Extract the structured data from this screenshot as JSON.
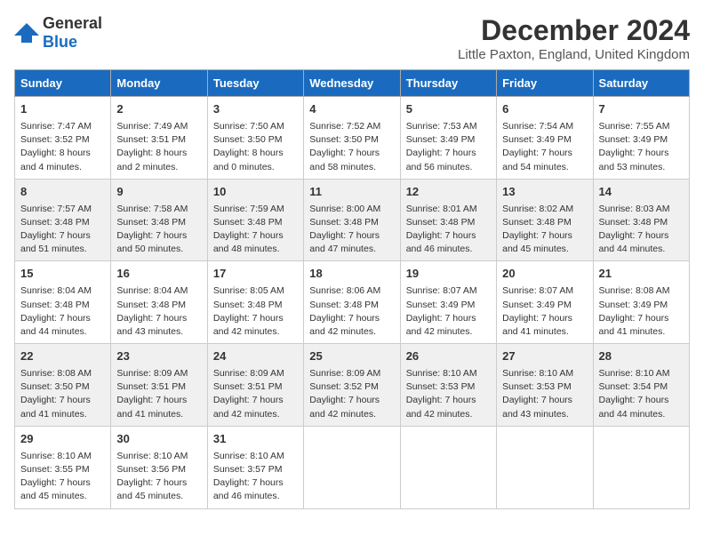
{
  "logo": {
    "general": "General",
    "blue": "Blue"
  },
  "title": "December 2024",
  "subtitle": "Little Paxton, England, United Kingdom",
  "colors": {
    "header_bg": "#1a6bbf",
    "odd_row": "#ffffff",
    "even_row": "#f0f0f0"
  },
  "columns": [
    "Sunday",
    "Monday",
    "Tuesday",
    "Wednesday",
    "Thursday",
    "Friday",
    "Saturday"
  ],
  "weeks": [
    [
      {
        "day": "1",
        "info": "Sunrise: 7:47 AM\nSunset: 3:52 PM\nDaylight: 8 hours\nand 4 minutes."
      },
      {
        "day": "2",
        "info": "Sunrise: 7:49 AM\nSunset: 3:51 PM\nDaylight: 8 hours\nand 2 minutes."
      },
      {
        "day": "3",
        "info": "Sunrise: 7:50 AM\nSunset: 3:50 PM\nDaylight: 8 hours\nand 0 minutes."
      },
      {
        "day": "4",
        "info": "Sunrise: 7:52 AM\nSunset: 3:50 PM\nDaylight: 7 hours\nand 58 minutes."
      },
      {
        "day": "5",
        "info": "Sunrise: 7:53 AM\nSunset: 3:49 PM\nDaylight: 7 hours\nand 56 minutes."
      },
      {
        "day": "6",
        "info": "Sunrise: 7:54 AM\nSunset: 3:49 PM\nDaylight: 7 hours\nand 54 minutes."
      },
      {
        "day": "7",
        "info": "Sunrise: 7:55 AM\nSunset: 3:49 PM\nDaylight: 7 hours\nand 53 minutes."
      }
    ],
    [
      {
        "day": "8",
        "info": "Sunrise: 7:57 AM\nSunset: 3:48 PM\nDaylight: 7 hours\nand 51 minutes."
      },
      {
        "day": "9",
        "info": "Sunrise: 7:58 AM\nSunset: 3:48 PM\nDaylight: 7 hours\nand 50 minutes."
      },
      {
        "day": "10",
        "info": "Sunrise: 7:59 AM\nSunset: 3:48 PM\nDaylight: 7 hours\nand 48 minutes."
      },
      {
        "day": "11",
        "info": "Sunrise: 8:00 AM\nSunset: 3:48 PM\nDaylight: 7 hours\nand 47 minutes."
      },
      {
        "day": "12",
        "info": "Sunrise: 8:01 AM\nSunset: 3:48 PM\nDaylight: 7 hours\nand 46 minutes."
      },
      {
        "day": "13",
        "info": "Sunrise: 8:02 AM\nSunset: 3:48 PM\nDaylight: 7 hours\nand 45 minutes."
      },
      {
        "day": "14",
        "info": "Sunrise: 8:03 AM\nSunset: 3:48 PM\nDaylight: 7 hours\nand 44 minutes."
      }
    ],
    [
      {
        "day": "15",
        "info": "Sunrise: 8:04 AM\nSunset: 3:48 PM\nDaylight: 7 hours\nand 44 minutes."
      },
      {
        "day": "16",
        "info": "Sunrise: 8:04 AM\nSunset: 3:48 PM\nDaylight: 7 hours\nand 43 minutes."
      },
      {
        "day": "17",
        "info": "Sunrise: 8:05 AM\nSunset: 3:48 PM\nDaylight: 7 hours\nand 42 minutes."
      },
      {
        "day": "18",
        "info": "Sunrise: 8:06 AM\nSunset: 3:48 PM\nDaylight: 7 hours\nand 42 minutes."
      },
      {
        "day": "19",
        "info": "Sunrise: 8:07 AM\nSunset: 3:49 PM\nDaylight: 7 hours\nand 42 minutes."
      },
      {
        "day": "20",
        "info": "Sunrise: 8:07 AM\nSunset: 3:49 PM\nDaylight: 7 hours\nand 41 minutes."
      },
      {
        "day": "21",
        "info": "Sunrise: 8:08 AM\nSunset: 3:49 PM\nDaylight: 7 hours\nand 41 minutes."
      }
    ],
    [
      {
        "day": "22",
        "info": "Sunrise: 8:08 AM\nSunset: 3:50 PM\nDaylight: 7 hours\nand 41 minutes."
      },
      {
        "day": "23",
        "info": "Sunrise: 8:09 AM\nSunset: 3:51 PM\nDaylight: 7 hours\nand 41 minutes."
      },
      {
        "day": "24",
        "info": "Sunrise: 8:09 AM\nSunset: 3:51 PM\nDaylight: 7 hours\nand 42 minutes."
      },
      {
        "day": "25",
        "info": "Sunrise: 8:09 AM\nSunset: 3:52 PM\nDaylight: 7 hours\nand 42 minutes."
      },
      {
        "day": "26",
        "info": "Sunrise: 8:10 AM\nSunset: 3:53 PM\nDaylight: 7 hours\nand 42 minutes."
      },
      {
        "day": "27",
        "info": "Sunrise: 8:10 AM\nSunset: 3:53 PM\nDaylight: 7 hours\nand 43 minutes."
      },
      {
        "day": "28",
        "info": "Sunrise: 8:10 AM\nSunset: 3:54 PM\nDaylight: 7 hours\nand 44 minutes."
      }
    ],
    [
      {
        "day": "29",
        "info": "Sunrise: 8:10 AM\nSunset: 3:55 PM\nDaylight: 7 hours\nand 45 minutes."
      },
      {
        "day": "30",
        "info": "Sunrise: 8:10 AM\nSunset: 3:56 PM\nDaylight: 7 hours\nand 45 minutes."
      },
      {
        "day": "31",
        "info": "Sunrise: 8:10 AM\nSunset: 3:57 PM\nDaylight: 7 hours\nand 46 minutes."
      },
      {
        "day": "",
        "info": ""
      },
      {
        "day": "",
        "info": ""
      },
      {
        "day": "",
        "info": ""
      },
      {
        "day": "",
        "info": ""
      }
    ]
  ]
}
